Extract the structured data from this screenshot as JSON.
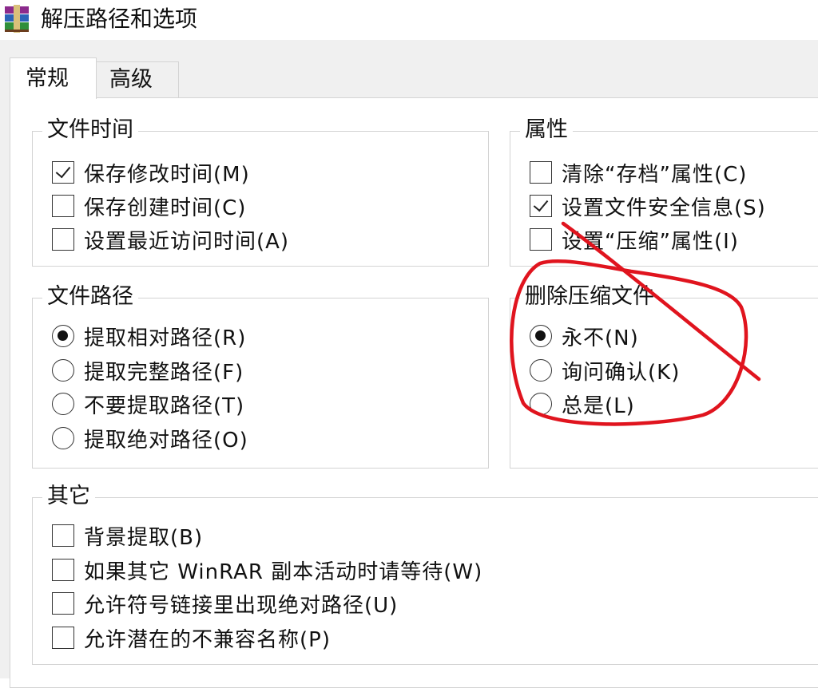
{
  "window": {
    "title": "解压路径和选项",
    "icon": "winrar-books-icon"
  },
  "tabs": [
    {
      "label": "常规",
      "active": true
    },
    {
      "label": "高级",
      "active": false
    }
  ],
  "file_time": {
    "legend": "文件时间",
    "options": [
      {
        "label": "保存修改时间(M)",
        "checked": true
      },
      {
        "label": "保存创建时间(C)",
        "checked": false
      },
      {
        "label": "设置最近访问时间(A)",
        "checked": false
      }
    ]
  },
  "attributes": {
    "legend": "属性",
    "options": [
      {
        "label": "清除“存档”属性(C)",
        "checked": false
      },
      {
        "label": "设置文件安全信息(S)",
        "checked": true
      },
      {
        "label": "设置“压缩”属性(I)",
        "checked": false
      }
    ]
  },
  "file_path": {
    "legend": "文件路径",
    "options": [
      {
        "label": "提取相对路径(R)",
        "selected": true
      },
      {
        "label": "提取完整路径(F)",
        "selected": false
      },
      {
        "label": "不要提取路径(T)",
        "selected": false
      },
      {
        "label": "提取绝对路径(O)",
        "selected": false
      }
    ]
  },
  "delete_archive": {
    "legend": "删除压缩文件",
    "options": [
      {
        "label": "永不(N)",
        "selected": true
      },
      {
        "label": "询问确认(K)",
        "selected": false
      },
      {
        "label": "总是(L)",
        "selected": false
      }
    ]
  },
  "misc": {
    "legend": "其它",
    "options": [
      {
        "label": "背景提取(B)",
        "checked": false
      },
      {
        "label": "如果其它 WinRAR 副本活动时请等待(W)",
        "checked": false
      },
      {
        "label": "允许符号链接里出现绝对路径(U)",
        "checked": false
      },
      {
        "label": "允许潜在的不兼容名称(P)",
        "checked": false
      }
    ]
  },
  "colors": {
    "annotation": "#e0141e",
    "dialog_bg": "#f0f0f0",
    "group_border": "#d3d3d3"
  }
}
